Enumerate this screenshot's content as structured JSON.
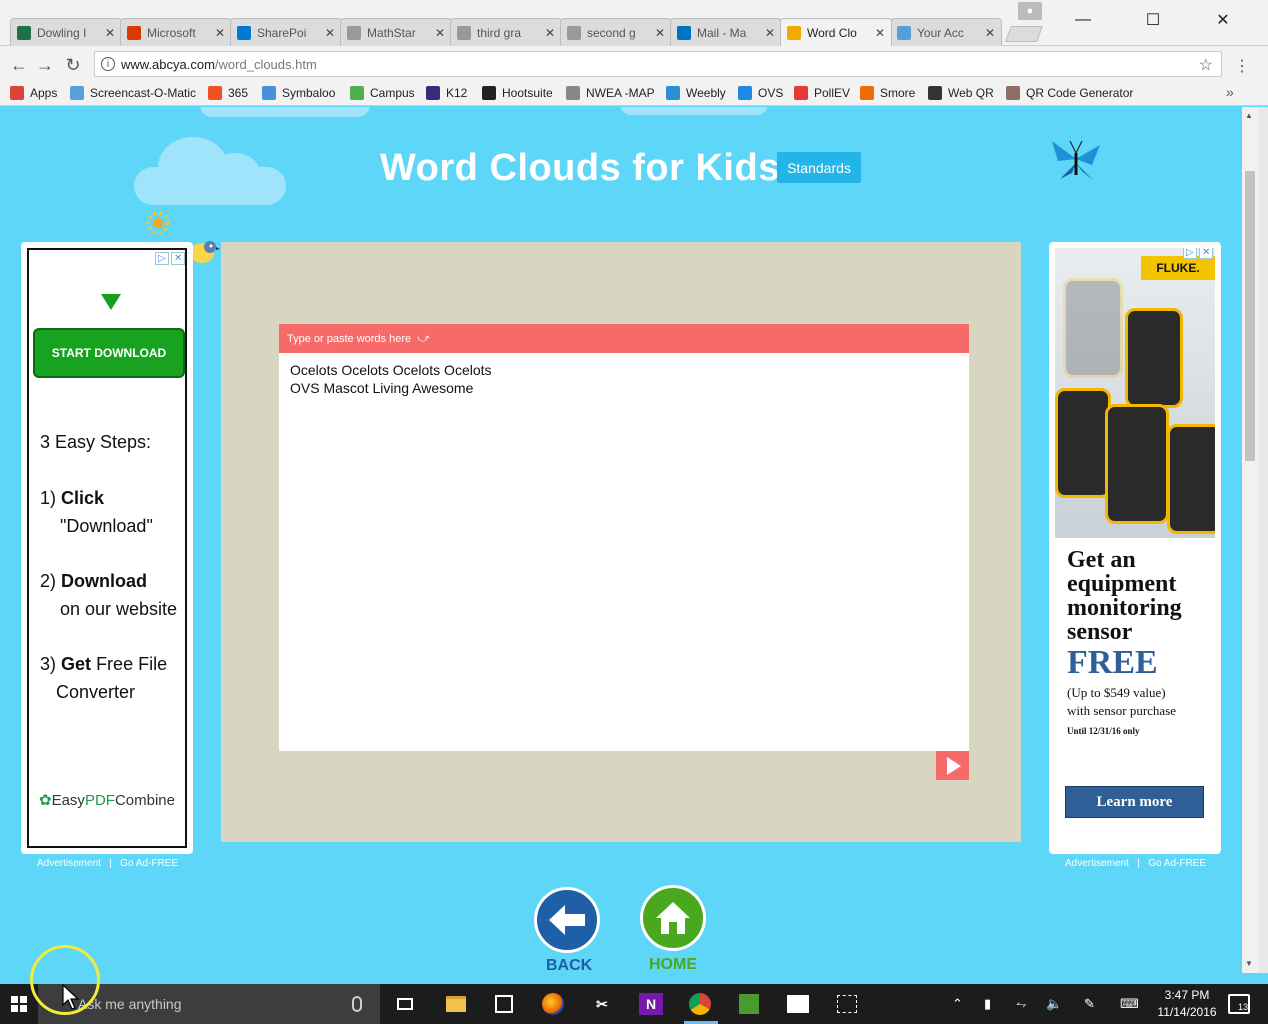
{
  "browser": {
    "tabs": [
      {
        "label": "Dowling I",
        "icon": "excel-icon",
        "color": "#1e7145"
      },
      {
        "label": "Microsoft",
        "icon": "office-icon",
        "color": "#d83b01"
      },
      {
        "label": "SharePoi",
        "icon": "sharepoint-icon",
        "color": "#0078d4"
      },
      {
        "label": "MathStar",
        "icon": "document-icon",
        "color": "#999999"
      },
      {
        "label": "third gra",
        "icon": "document-icon",
        "color": "#999999"
      },
      {
        "label": "second g",
        "icon": "document-icon",
        "color": "#999999"
      },
      {
        "label": "Mail - Ma",
        "icon": "mail-icon",
        "color": "#0072c6"
      },
      {
        "label": "Word Clo",
        "icon": "abcya-icon",
        "color": "#f2a900"
      },
      {
        "label": "Your Acc",
        "icon": "account-icon",
        "color": "#5aa0d8"
      }
    ],
    "close_glyph": "✕",
    "active_tab_index": 7,
    "url_host": "www.abcya.com",
    "url_path": "/word_clouds.htm",
    "bookmarks": [
      {
        "label": "Apps",
        "icon": "apps-icon",
        "color": "#db4437"
      },
      {
        "label": "Screencast-O-Matic",
        "icon": "screencast-icon",
        "color": "#5aa0d8"
      },
      {
        "label": "365",
        "icon": "office365-icon",
        "color": "#f25022"
      },
      {
        "label": "Symbaloo",
        "icon": "symbaloo-icon",
        "color": "#4a90d9"
      },
      {
        "label": "Campus",
        "icon": "campus-icon",
        "color": "#4caf50"
      },
      {
        "label": "K12",
        "icon": "k12-icon",
        "color": "#3a2a7a"
      },
      {
        "label": "Hootsuite",
        "icon": "hootsuite-icon",
        "color": "#222222"
      },
      {
        "label": "NWEA -MAP",
        "icon": "nwea-icon",
        "color": "#888888"
      },
      {
        "label": "Weebly",
        "icon": "weebly-icon",
        "color": "#2b8fd8"
      },
      {
        "label": "OVS",
        "icon": "cloud-icon",
        "color": "#1e88e5"
      },
      {
        "label": "PollEV",
        "icon": "pollev-icon",
        "color": "#e53935"
      },
      {
        "label": "Smore",
        "icon": "smore-icon",
        "color": "#ef6c00"
      },
      {
        "label": "Web QR",
        "icon": "qr-icon",
        "color": "#333333"
      },
      {
        "label": "QR Code Generator",
        "icon": "qr-generator-icon",
        "color": "#8d6e63"
      }
    ]
  },
  "page": {
    "title": "Word Clouds for Kids",
    "standards_label": "Standards",
    "left_ad": {
      "cta": "START DOWNLOAD",
      "steps_title": "3 Easy Steps:",
      "step1_num": "1)",
      "step1_bold": "Click",
      "step1_rest": "\"Download\"",
      "step2_num": "2)",
      "step2_bold": "Download",
      "step2_rest": "on our website",
      "step3_num": "3)",
      "step3_bold": "Get",
      "step3_rest_a": "Free File",
      "step3_rest_b": "Converter",
      "brand_a": "Easy",
      "brand_b": "PDF",
      "brand_c": "Combine"
    },
    "ad_footer": {
      "advertisement": "Advertisement",
      "separator": "|",
      "ad_free": "Go Ad-FREE"
    },
    "word_cloud": {
      "header": "Type or paste words here",
      "text_line1": "Ocelots Ocelots Ocelots Ocelots",
      "text_line2": "OVS Mascot Living Awesome"
    },
    "right_ad": {
      "brand": "FLUKE.",
      "headline_1": "Get an",
      "headline_2": "equipment",
      "headline_3": "monitoring",
      "headline_4": "sensor",
      "free": "FREE",
      "sub_1": "(Up to $549 value)",
      "sub_2": "with sensor purchase",
      "until": "Until 12/31/16 only",
      "cta": "Learn more"
    },
    "nav": {
      "back_label": "BACK",
      "home_label": "HOME",
      "back_color": "#1f5fa8",
      "home_color": "#4aa81e"
    }
  },
  "taskbar": {
    "search_placeholder": "Ask me anything",
    "time": "3:47 PM",
    "date": "11/14/2016",
    "notification_count": "13"
  }
}
